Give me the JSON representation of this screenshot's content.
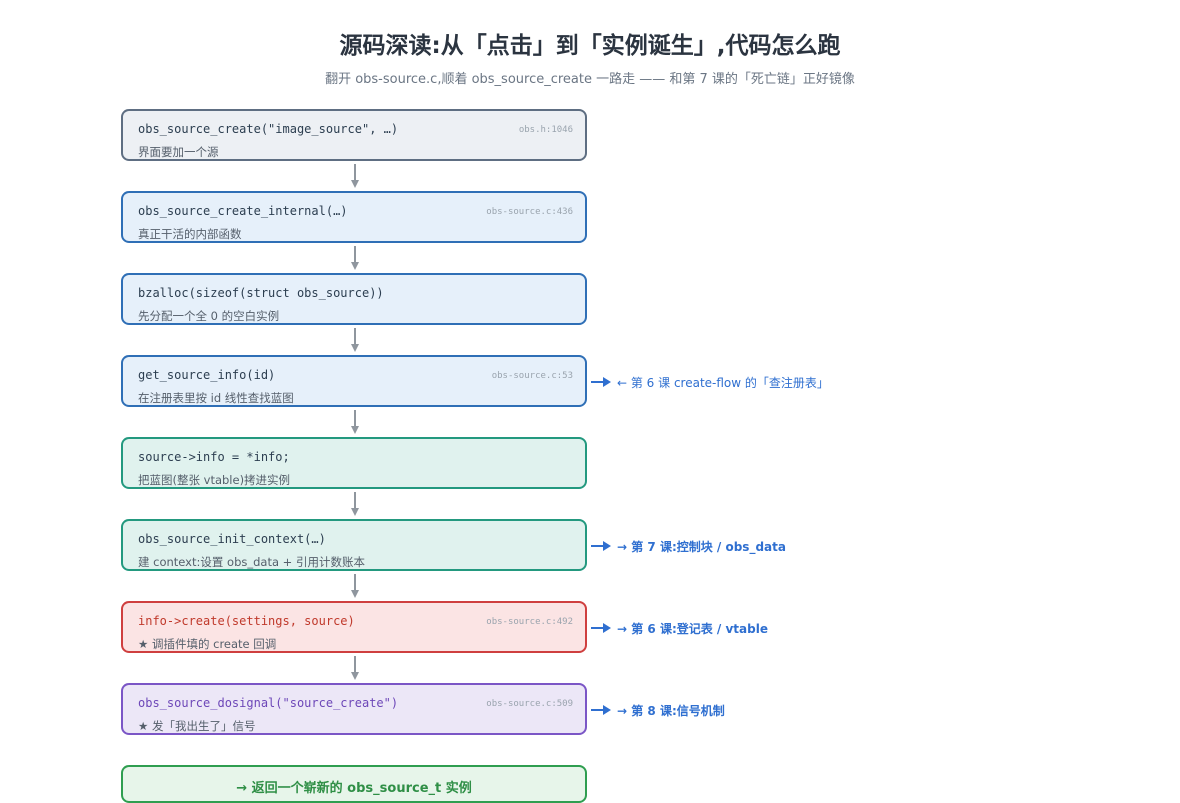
{
  "header": {
    "title": "源码深读:从「点击」到「实例诞生」,代码怎么跑",
    "subtitle": "翻开 obs-source.c,顺着 obs_source_create 一路走 —— 和第 7 课的「死亡链」正好镜像"
  },
  "steps": [
    {
      "code": "obs_source_create(\"image_source\", …)",
      "ref": "obs.h:1046",
      "desc": "界面要加一个源",
      "variant": "gray"
    },
    {
      "code": "obs_source_create_internal(…)",
      "ref": "obs-source.c:436",
      "desc": "真正干活的内部函数",
      "variant": "blue"
    },
    {
      "code": "bzalloc(sizeof(struct obs_source))",
      "ref": "",
      "desc": "先分配一个全 0 的空白实例",
      "variant": "blue"
    },
    {
      "code": "get_source_info(id)",
      "ref": "obs-source.c:53",
      "desc": "在注册表里按 id 线性查找蓝图",
      "variant": "blue"
    },
    {
      "code": "source->info = *info;",
      "ref": "",
      "desc": "把蓝图(整张 vtable)拷进实例",
      "variant": "teal"
    },
    {
      "code": "obs_source_init_context(…)",
      "ref": "",
      "desc": "建 context:设置 obs_data + 引用计数账本",
      "variant": "teal"
    },
    {
      "code": "info->create(settings, source)",
      "ref": "obs-source.c:492",
      "desc": "★ 调插件填的 create 回调",
      "variant": "red"
    },
    {
      "code": "obs_source_dosignal(\"source_create\")",
      "ref": "obs-source.c:509",
      "desc": "★ 发「我出生了」信号",
      "variant": "purple"
    }
  ],
  "result": {
    "label": "→ 返回一个崭新的 obs_source_t 实例"
  },
  "side_notes": {
    "step4": "← 第 6 课 create-flow 的「查注册表」",
    "step6": "→ 第 7 课:控制块 / obs_data",
    "step7": "→ 第 6 课:登记表 / vtable",
    "step8": "→ 第 8 课:信号机制"
  },
  "colors": {
    "arrow_gray": "#8f969e",
    "side_arrow_blue": "#2f6fd0",
    "border_gray": "#5e6e82",
    "border_blue": "#2f6fb6",
    "border_teal": "#23997f",
    "border_red": "#cf3f3f",
    "border_purple": "#7b56c6",
    "border_green": "#2f9e50"
  }
}
